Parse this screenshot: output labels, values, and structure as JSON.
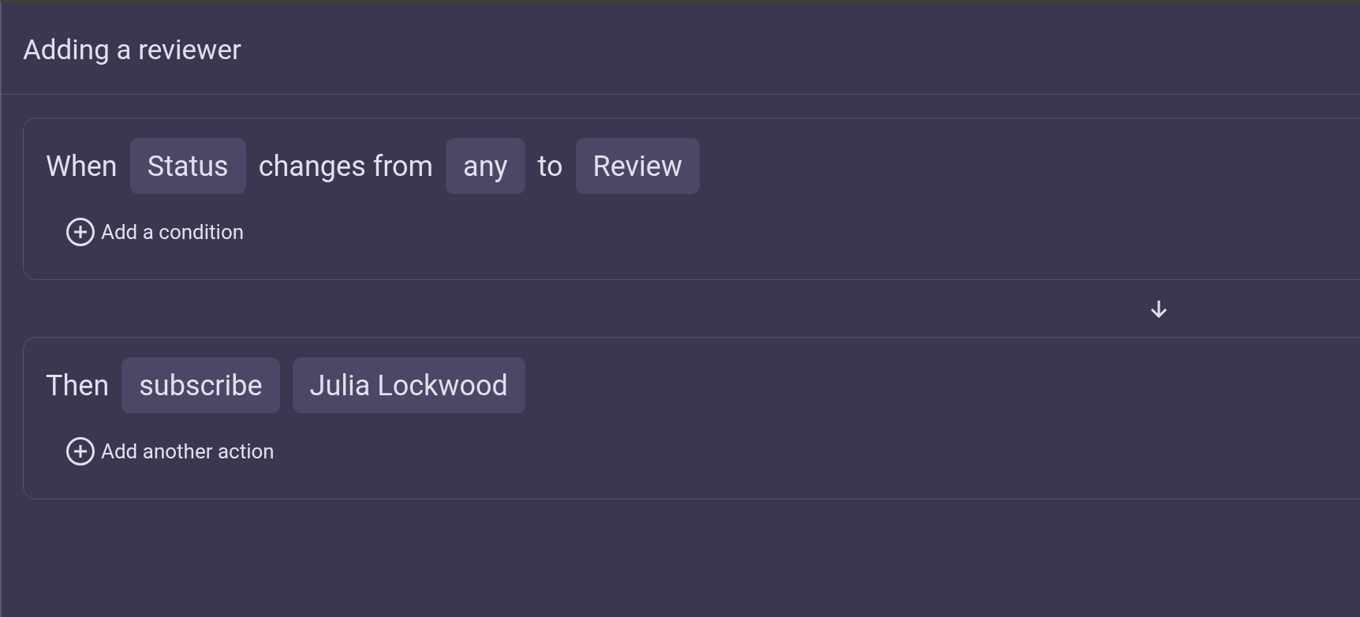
{
  "title": "Adding a reviewer",
  "blocks": [
    {
      "parts": [
        {
          "kind": "word",
          "text": "When"
        },
        {
          "kind": "chip",
          "text": "Status"
        },
        {
          "kind": "word",
          "text": "changes from"
        },
        {
          "kind": "chip",
          "text": "any"
        },
        {
          "kind": "word",
          "text": "to"
        },
        {
          "kind": "chip",
          "text": "Review"
        }
      ],
      "add_label": "Add a condition"
    },
    {
      "parts": [
        {
          "kind": "word",
          "text": "Then"
        },
        {
          "kind": "chip",
          "text": "subscribe"
        },
        {
          "kind": "chip",
          "text": "Julia Lockwood"
        }
      ],
      "add_label": "Add another action"
    }
  ]
}
